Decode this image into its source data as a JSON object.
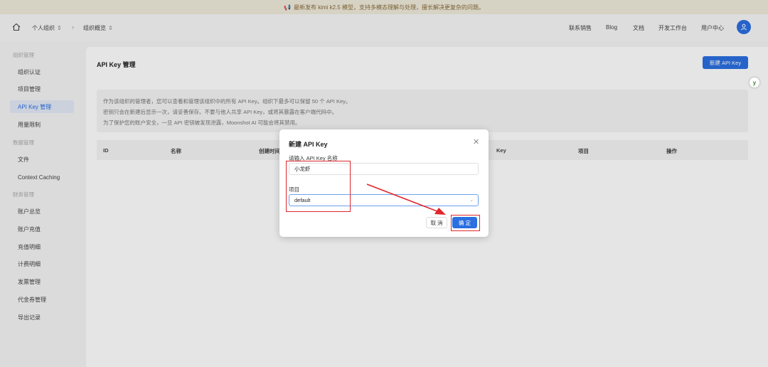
{
  "banner": {
    "icon": "megaphone-icon",
    "text": "最新发布 kimi k2.5 模型，支持多模态理解与处理，擅长解决更复杂的问题。"
  },
  "topbar": {
    "org": "个人组织",
    "overview": "组织概览",
    "nav": [
      "联系销售",
      "Blog",
      "文档",
      "开发工作台",
      "用户中心"
    ]
  },
  "sidebar": {
    "groups": [
      "组织管理",
      "数据管理",
      "财务管理"
    ],
    "items": [
      "组织认证",
      "项目管理",
      "API Key 管理",
      "用量限制",
      "文件",
      "Context Caching",
      "账户总览",
      "账户充值",
      "充值明细",
      "计费明细",
      "发票管理",
      "代金券管理",
      "导出记录"
    ],
    "active": "API Key 管理"
  },
  "main": {
    "title": "API Key 管理",
    "new_button": "新建 API Key",
    "notice": [
      "作为该组织的管理者，您可以查看和管理该组织中的所有 API Key。组织下最多可以保留 50 个 API Key。",
      "密钥只会在新建后显示一次，请妥善保存。不要与他人共享 API Key，或将其暴露在客户端代码中。",
      "为了保护您的账户安全，一旦 API 密钥被发现泄露，Moonshot AI 可能会将其禁用。"
    ],
    "columns": [
      "ID",
      "名称",
      "创建时间",
      "Key",
      "项目",
      "操作"
    ]
  },
  "modal": {
    "title": "新建 API Key",
    "name_label": "请输入 API Key 名称",
    "name_value": "小龙虾",
    "project_label": "项目",
    "project_value": "default",
    "cancel": "取 消",
    "confirm": "确 定"
  },
  "badge": "y",
  "colors": {
    "accent": "#2b6fe0",
    "highlight": "#e0262d",
    "banner_bg": "#efeadb"
  }
}
